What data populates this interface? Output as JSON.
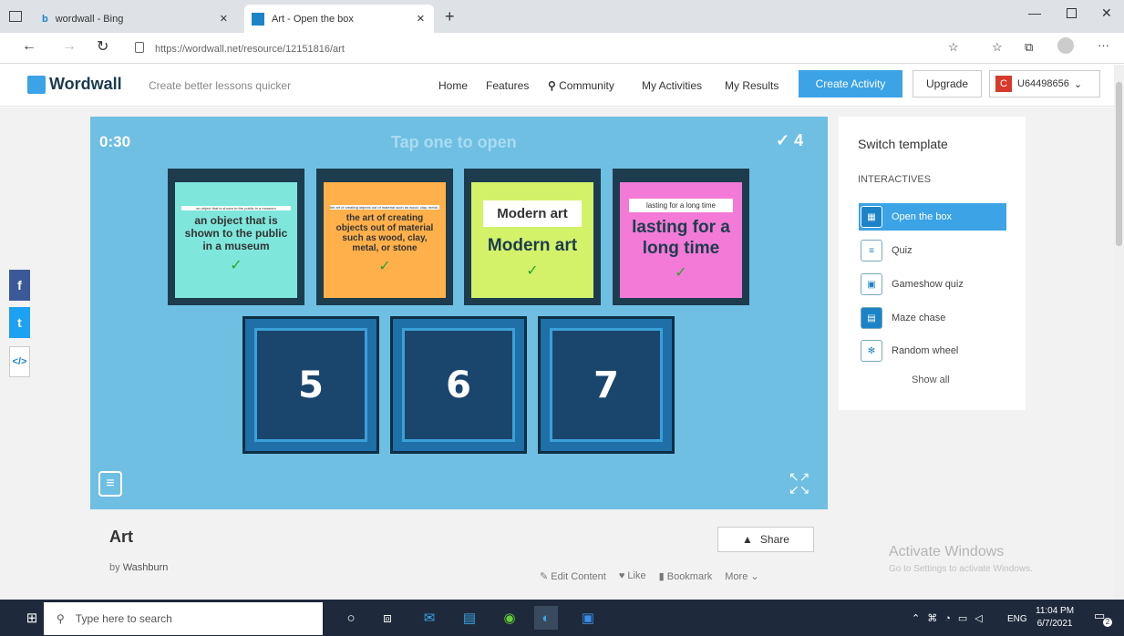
{
  "browser": {
    "tabs": [
      {
        "title": "wordwall - Bing",
        "icon": "bing-icon"
      },
      {
        "title": "Art - Open the box",
        "icon": "wordwall-icon"
      }
    ],
    "url": "https://wordwall.net/resource/12151816/art",
    "window_controls": [
      "minimize",
      "maximize",
      "close"
    ]
  },
  "header": {
    "logo": "Wordwall",
    "tagline": "Create better lessons quicker",
    "nav": [
      "Home",
      "Features",
      "Community",
      "My Activities",
      "My Results"
    ],
    "create_label": "Create Activity",
    "upgrade_label": "Upgrade",
    "user_initial": "C",
    "user_id": "U64498656"
  },
  "game": {
    "timer": "0:30",
    "prompt": "Tap one to open",
    "score": "4",
    "opened_cards": [
      {
        "small": "an object that is shown to the public in a museum",
        "main": "an object that is shown to the public in a museum",
        "color": "#7fe6dc"
      },
      {
        "small": "the art of creating objects out of material such as wood, clay, metal, or stone",
        "main": "the art of creating objects out of material such as wood, clay, metal, or stone",
        "color": "#ffb04a"
      },
      {
        "small": "Modern art",
        "main": "Modern art",
        "color": "#d3f26a"
      },
      {
        "small": "lasting for a long time",
        "main": "lasting for a long time",
        "color": "#f37ad6"
      }
    ],
    "closed_cards": [
      "5",
      "6",
      "7"
    ]
  },
  "activity": {
    "title": "Art",
    "author_prefix": "by",
    "author": "Washburn",
    "share_label": "Share",
    "actions": [
      "Edit Content",
      "Like",
      "Bookmark",
      "More"
    ]
  },
  "sidebar": {
    "title": "Switch template",
    "section": "INTERACTIVES",
    "items": [
      {
        "label": "Open the box",
        "active": true
      },
      {
        "label": "Quiz",
        "active": false
      },
      {
        "label": "Gameshow quiz",
        "active": false
      },
      {
        "label": "Maze chase",
        "active": false
      },
      {
        "label": "Random wheel",
        "active": false
      }
    ],
    "show_all": "Show all"
  },
  "watermark": {
    "title": "Activate Windows",
    "subtitle": "Go to Settings to activate Windows."
  },
  "taskbar": {
    "search_placeholder": "Type here to search",
    "language": "ENG",
    "time": "11:04 PM",
    "date": "6/7/2021",
    "notif_count": "2"
  },
  "colors": {
    "accent": "#3ba3e6",
    "game_bg": "#6fbfe3",
    "check": "#2aa52a"
  }
}
